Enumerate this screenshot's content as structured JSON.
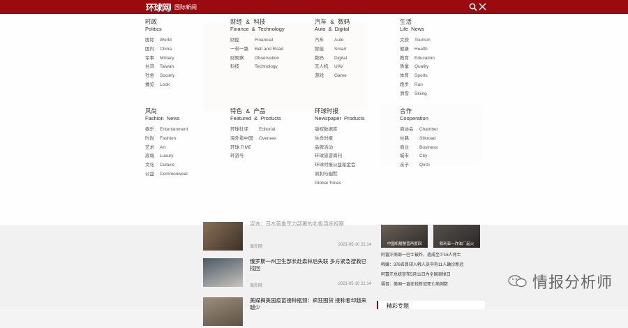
{
  "header": {
    "logo": "环球网",
    "channel": "国际新闻",
    "bg_color": "#9a0b0f",
    "search_icon": "search-icon",
    "close_icon": "close-icon"
  },
  "menu": {
    "sections": [
      {
        "cn": "时政",
        "en": "Politics",
        "items": [
          {
            "zh": "国际",
            "en": "World"
          },
          {
            "zh": "国内",
            "en": "China"
          },
          {
            "zh": "军事",
            "en": "Military"
          },
          {
            "zh": "台湾",
            "en": "Taiwan"
          },
          {
            "zh": "社会",
            "en": "Society"
          },
          {
            "zh": "播览",
            "en": "Look"
          }
        ]
      },
      {
        "cn": "财经 & 科技",
        "en": "Finance & Technology",
        "items": [
          {
            "zh": "财经",
            "en": "Financial"
          },
          {
            "zh": "一带一路",
            "en": "Belt and Road"
          },
          {
            "zh": "财观察",
            "en": "Observation"
          },
          {
            "zh": "科技",
            "en": "Technology"
          }
        ]
      },
      {
        "cn": "汽车 & 数码",
        "en": "Auto & Digital",
        "items": [
          {
            "zh": "汽车",
            "en": "Auto"
          },
          {
            "zh": "智能",
            "en": "Smart"
          },
          {
            "zh": "数码",
            "en": "Digital"
          },
          {
            "zh": "无人机",
            "en": "UAV"
          },
          {
            "zh": "游戏",
            "en": "Game"
          }
        ]
      },
      {
        "cn": "生活",
        "en": "Life News",
        "items": [
          {
            "zh": "文旅",
            "en": "Tourism"
          },
          {
            "zh": "健康",
            "en": "Health"
          },
          {
            "zh": "教育",
            "en": "Education"
          },
          {
            "zh": "质量",
            "en": "Quality"
          },
          {
            "zh": "体育",
            "en": "Sports"
          },
          {
            "zh": "跑步",
            "en": "Run"
          },
          {
            "zh": "滑雪",
            "en": "Skiing"
          }
        ]
      },
      {
        "cn": "风尚",
        "en": "Fashion News",
        "items": [
          {
            "zh": "娱乐",
            "en": "Entertainment"
          },
          {
            "zh": "时尚",
            "en": "Fashion"
          },
          {
            "zh": "艺术",
            "en": "Art"
          },
          {
            "zh": "高端",
            "en": "Luxury"
          },
          {
            "zh": "文化",
            "en": "Culture"
          },
          {
            "zh": "公益",
            "en": "Commonweal"
          }
        ]
      },
      {
        "cn": "特色 & 产品",
        "en": "Featured & Products",
        "items": [
          {
            "zh": "环球社评",
            "en": "Editorial"
          },
          {
            "zh": "海外看中国",
            "en": "Oversee"
          },
          {
            "zh": "环球 TIME",
            "en": ""
          },
          {
            "zh": "环游号",
            "en": ""
          }
        ]
      },
      {
        "cn": "环球时报",
        "en": "Newspaper Products",
        "items": [
          {
            "zh": "版权数据库",
            "en": ""
          },
          {
            "zh": "生命时报",
            "en": ""
          },
          {
            "zh": "品牌活动",
            "en": ""
          },
          {
            "zh": "环球旅游周刊",
            "en": ""
          },
          {
            "zh": "环球时报公益基金会",
            "en": ""
          },
          {
            "zh": "讽刺与幽默",
            "en": ""
          },
          {
            "zh": "Global Times",
            "en": ""
          }
        ]
      },
      {
        "cn": "合作",
        "en": "Cooperation",
        "items": [
          {
            "zh": "商协会",
            "en": "Chamber"
          },
          {
            "zh": "丝路",
            "en": "Silkroad"
          },
          {
            "zh": "商业",
            "en": "Business"
          },
          {
            "zh": "城市",
            "en": "City"
          },
          {
            "zh": "亲子",
            "en": "Qinzi"
          }
        ]
      }
    ]
  },
  "news": [
    {
      "headline": "咨询：日本首重军力部署的北极演练视察",
      "source": "海外网",
      "date": "2021-05-10 21:14"
    },
    {
      "headline": "俄罗斯一州卫生部长赴森林后失联 多方紧急搜救已找回",
      "source": "海外网",
      "date": "2021-05-10 21:14"
    },
    {
      "headline": "美媒揭美国疫苗接种瓶颈：疯狂囤货 接种者却越来越少",
      "source": "",
      "date": ""
    }
  ],
  "right_panel": {
    "images": [
      {
        "caption": "中国机舰警营再度回"
      },
      {
        "caption": "叙利亚一炸油厂起火"
      }
    ],
    "links": [
      "阿富汗南部一巴士被炸，造成至少16人死亡",
      "韩媒：376名目印入韩人员中有11人确诊新冠",
      "阿富汗总统宣布5月11日为全国哀悼日",
      "福音：美国一直在找新冠死亡病例数"
    ],
    "hot_title": "精彩专题"
  },
  "watermark": {
    "text": "情报分析师",
    "icon": "wechat-icon"
  }
}
